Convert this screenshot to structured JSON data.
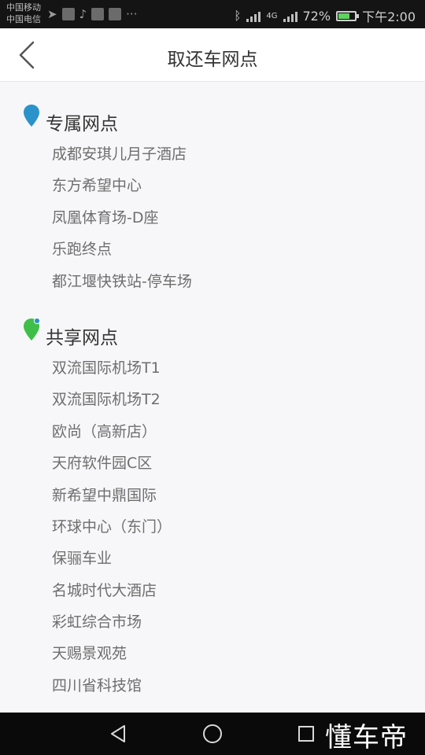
{
  "status_bar": {
    "carrier_1": "中国移动",
    "carrier_2": "中国电信",
    "more": "···",
    "network": "4G",
    "battery": "72%",
    "battery_level": 0.72,
    "time": "下午2:00"
  },
  "header": {
    "title": "取还车网点"
  },
  "sections": [
    {
      "title": "专属网点",
      "pin_color": "#2b93c9",
      "items": [
        "成都安琪儿月子酒店",
        "东方希望中心",
        "凤凰体育场-D座",
        "乐跑终点",
        "都江堰快铁站-停车场"
      ]
    },
    {
      "title": "共享网点",
      "pin_color": "#3fbf4a",
      "items": [
        "双流国际机场T1",
        "双流国际机场T2",
        "欧尚（高新店）",
        "天府软件园C区",
        "新希望中鼎国际",
        "环球中心（东门）",
        "保骊车业",
        "名城时代大酒店",
        "彩虹综合市场",
        "天赐景观苑",
        "四川省科技馆"
      ]
    }
  ],
  "watermark": "懂车帝"
}
